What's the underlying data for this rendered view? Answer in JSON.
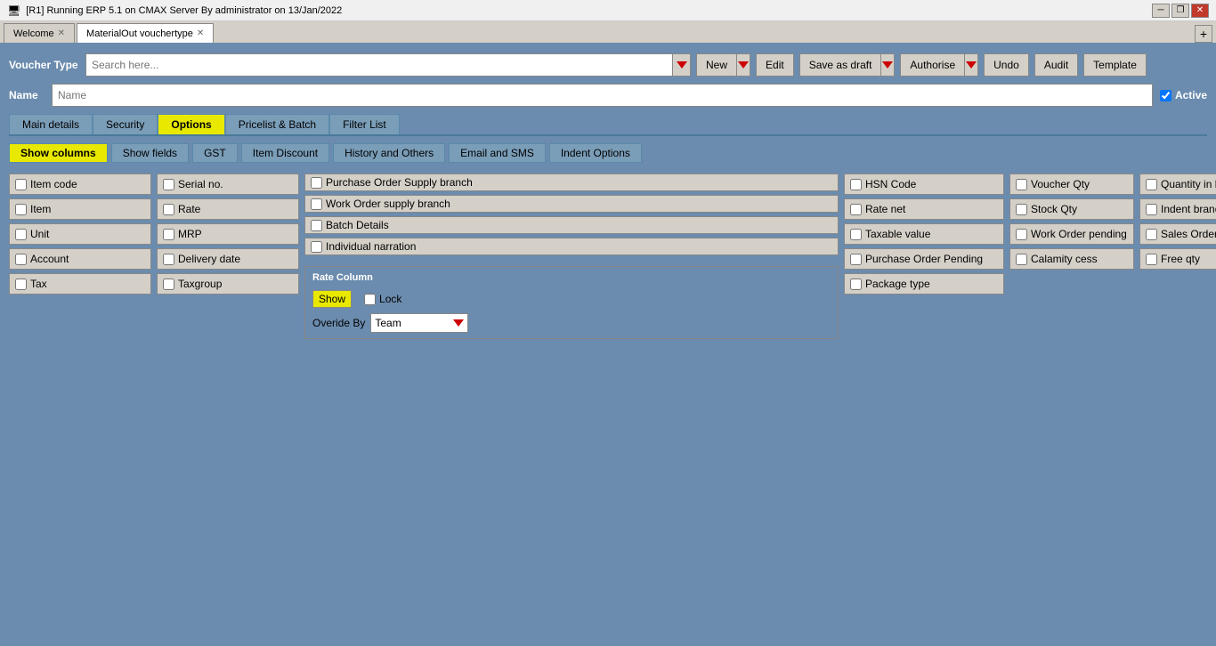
{
  "titlebar": {
    "title": "[R1] Running ERP 5.1 on CMAX Server By administrator on 13/Jan/2022",
    "controls": [
      "minimize",
      "restore",
      "close"
    ]
  },
  "tabs": [
    {
      "id": "welcome",
      "label": "Welcome",
      "active": false,
      "closable": true
    },
    {
      "id": "materialout",
      "label": "MaterialOut vouchertype",
      "active": true,
      "closable": true
    }
  ],
  "tab_add_label": "+",
  "toolbar": {
    "voucher_type_label": "Voucher Type",
    "search_placeholder": "Search here...",
    "new_label": "New",
    "edit_label": "Edit",
    "save_as_draft_label": "Save as draft",
    "authorise_label": "Authorise",
    "undo_label": "Undo",
    "audit_label": "Audit",
    "template_label": "Template"
  },
  "name_row": {
    "label": "Name",
    "placeholder": "Name",
    "active_label": "Active",
    "active_checked": true
  },
  "nav_tabs": [
    {
      "id": "main-details",
      "label": "Main details",
      "active": false
    },
    {
      "id": "security",
      "label": "Security",
      "active": false
    },
    {
      "id": "options",
      "label": "Options",
      "active": true
    },
    {
      "id": "pricelist-batch",
      "label": "Pricelist & Batch",
      "active": false
    },
    {
      "id": "filter-list",
      "label": "Filter List",
      "active": false
    }
  ],
  "sub_tabs": [
    {
      "id": "show-columns",
      "label": "Show columns",
      "active": true
    },
    {
      "id": "show-fields",
      "label": "Show fields",
      "active": false
    },
    {
      "id": "gst",
      "label": "GST",
      "active": false
    },
    {
      "id": "item-discount",
      "label": "Item Discount",
      "active": false
    },
    {
      "id": "history-others",
      "label": "History and Others",
      "active": false
    },
    {
      "id": "email-sms",
      "label": "Email and SMS",
      "active": false
    },
    {
      "id": "indent-options",
      "label": "Indent Options",
      "active": false
    }
  ],
  "checkboxes": {
    "col1": [
      {
        "id": "item-code",
        "label": "Item code",
        "checked": false
      },
      {
        "id": "item",
        "label": "Item",
        "checked": false
      },
      {
        "id": "unit",
        "label": "Unit",
        "checked": false
      },
      {
        "id": "account",
        "label": "Account",
        "checked": false
      },
      {
        "id": "tax",
        "label": "Tax",
        "checked": false
      }
    ],
    "col2": [
      {
        "id": "serial-no",
        "label": "Serial no.",
        "checked": false
      },
      {
        "id": "rate",
        "label": "Rate",
        "checked": false
      },
      {
        "id": "mrp",
        "label": "MRP",
        "checked": false
      },
      {
        "id": "delivery-date",
        "label": "Delivery date",
        "checked": false
      },
      {
        "id": "taxgroup",
        "label": "Taxgroup",
        "checked": false
      }
    ],
    "col_mid": [
      {
        "id": "purchase-order-supply-branch",
        "label": "Purchase Order Supply branch",
        "checked": false
      },
      {
        "id": "work-order-supply-branch",
        "label": "Work Order supply branch",
        "checked": false
      },
      {
        "id": "batch-details",
        "label": "Batch Details",
        "checked": false
      },
      {
        "id": "individual-narration",
        "label": "Individual narration",
        "checked": false
      }
    ],
    "col_r1": [
      {
        "id": "hsn-code",
        "label": "HSN  Code",
        "checked": false
      },
      {
        "id": "rate-net",
        "label": "Rate net",
        "checked": false
      },
      {
        "id": "taxable-value",
        "label": "Taxable value",
        "checked": false
      },
      {
        "id": "purchase-order-pending",
        "label": "Purchase Order Pending",
        "checked": false
      },
      {
        "id": "package-type",
        "label": "Package type",
        "checked": false
      }
    ],
    "col_r2": [
      {
        "id": "voucher-qty",
        "label": "Voucher Qty",
        "checked": false
      },
      {
        "id": "stock-qty",
        "label": "Stock Qty",
        "checked": false
      },
      {
        "id": "work-order-pending",
        "label": "Work Order pending",
        "checked": false
      },
      {
        "id": "calamity-cess",
        "label": "Calamity cess",
        "checked": false
      }
    ],
    "col_r3": [
      {
        "id": "quantity-in-base-unit",
        "label": "Quantity in base unit",
        "checked": false
      },
      {
        "id": "indent-branch",
        "label": "Indent branch",
        "checked": false
      },
      {
        "id": "sales-order-pending",
        "label": "Sales Order pending",
        "checked": false
      },
      {
        "id": "free-qty",
        "label": "Free qty",
        "checked": false
      }
    ]
  },
  "rate_column": {
    "group_label": "Rate Column",
    "show_label": "Show",
    "lock_label": "Lock",
    "override_label": "Overide By",
    "override_value": "Team"
  }
}
